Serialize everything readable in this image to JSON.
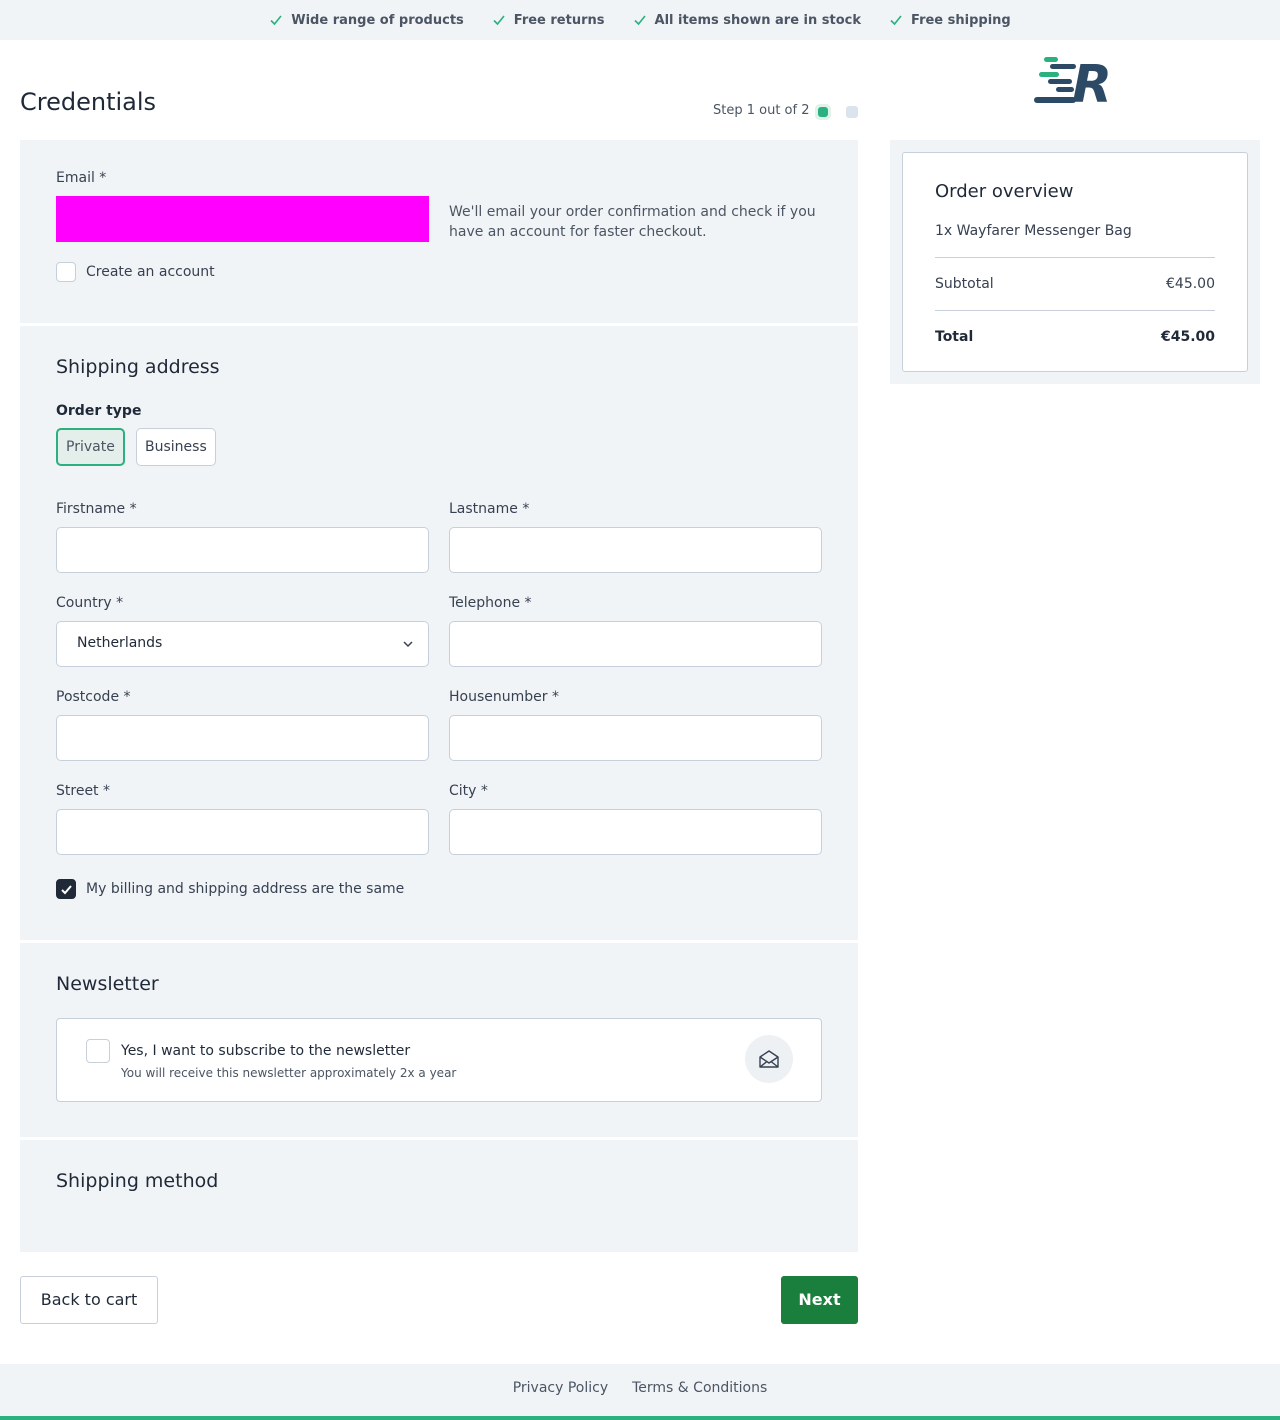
{
  "usps": [
    {
      "icon": "check-icon",
      "label": "Wide range of products"
    },
    {
      "icon": "check-icon",
      "label": "Free returns"
    },
    {
      "icon": "check-icon",
      "label": "All items shown are in stock"
    },
    {
      "icon": "check-icon",
      "label": "Free shipping"
    }
  ],
  "header": {
    "title": "Credentials",
    "step_text": "Step 1 out of 2",
    "logo_text": "R"
  },
  "email_section": {
    "label": "Email *",
    "value": "",
    "help": "We'll email your order confirmation and check if you have an account for faster checkout.",
    "create_account_label": "Create an account",
    "create_account_checked": false
  },
  "shipping": {
    "title": "Shipping address",
    "order_type_label": "Order type",
    "order_types": [
      "Private",
      "Business"
    ],
    "order_type_selected": "Private",
    "fields": {
      "firstname": {
        "label": "Firstname *",
        "value": ""
      },
      "lastname": {
        "label": "Lastname *",
        "value": ""
      },
      "country": {
        "label": "Country *",
        "value": "Netherlands"
      },
      "telephone": {
        "label": "Telephone *",
        "value": ""
      },
      "postcode": {
        "label": "Postcode *",
        "value": ""
      },
      "housenumber": {
        "label": "Housenumber *",
        "value": ""
      },
      "street": {
        "label": "Street *",
        "value": ""
      },
      "city": {
        "label": "City *",
        "value": ""
      }
    },
    "same_address_label": "My billing and shipping address are the same",
    "same_address_checked": true
  },
  "newsletter": {
    "title": "Newsletter",
    "option_label": "Yes, I want to subscribe to the newsletter",
    "option_sub": "You will receive this newsletter approximately 2x a year",
    "checked": false,
    "icon": "envelope-open-icon"
  },
  "shipping_method": {
    "title": "Shipping method"
  },
  "actions": {
    "back_label": "Back to cart",
    "next_label": "Next"
  },
  "order_overview": {
    "title": "Order overview",
    "item": "1x Wayfarer Messenger Bag",
    "subtotal_label": "Subtotal",
    "subtotal_value": "€45.00",
    "total_label": "Total",
    "total_value": "€45.00"
  },
  "footer": {
    "links": [
      "Privacy Policy",
      "Terms & Conditions"
    ]
  },
  "colors": {
    "accent": "#2bb07f",
    "primary_button": "#1a7f3c",
    "panel_bg": "#f1f4f7",
    "logo_dark": "#2c4a66"
  }
}
